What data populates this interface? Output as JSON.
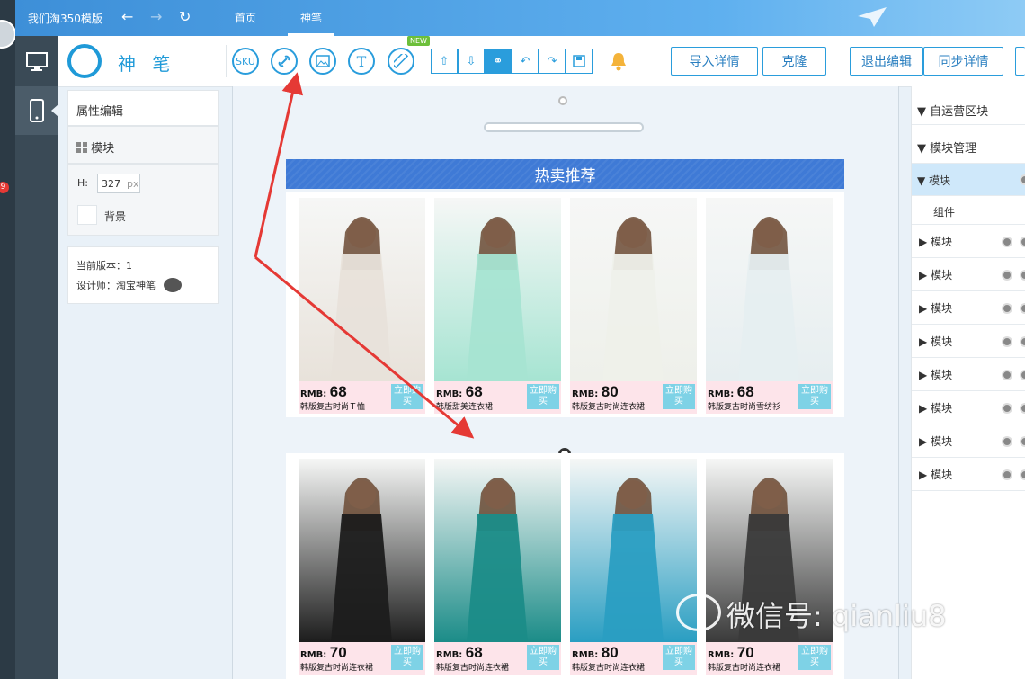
{
  "app": {
    "title": "我们淘350模版"
  },
  "top_tabs": [
    {
      "label": "首页"
    },
    {
      "label": "神笔"
    }
  ],
  "logo": {
    "text": "神 笔"
  },
  "toolbar": {
    "circle_icons": [
      {
        "name": "sku-icon",
        "label": "SKU"
      },
      {
        "name": "link-icon",
        "label": ""
      },
      {
        "name": "image-icon",
        "label": ""
      },
      {
        "name": "text-icon",
        "label": "T"
      },
      {
        "name": "ruler-icon",
        "label": ""
      }
    ],
    "new_badge": "NEW",
    "actions": [
      {
        "name": "import-detail-button",
        "label": "导入详情"
      },
      {
        "name": "clone-button",
        "label": "克隆"
      },
      {
        "name": "exit-edit-button",
        "label": "退出编辑"
      },
      {
        "name": "sync-detail-button",
        "label": "同步详情"
      }
    ]
  },
  "props": {
    "header": "属性编辑",
    "module_label": "模块",
    "height_label": "H:",
    "height_value": "327",
    "height_unit": "px",
    "background_label": "背景",
    "version_text": "当前版本：1",
    "designer_text": "设计师：淘宝神笔"
  },
  "canvas": {
    "banner_title": "热卖推荐",
    "row1": [
      {
        "rmb": "RMB:",
        "price": "68",
        "name": "韩版复古时尚Ｔ恤",
        "buy": "立即购买",
        "color": "#e8e2da"
      },
      {
        "rmb": "RMB:",
        "price": "68",
        "name": "韩版甜美连衣裙",
        "buy": "立即购买",
        "color": "#a6e4d2"
      },
      {
        "rmb": "RMB:",
        "price": "80",
        "name": "韩版复古时尚连衣裙",
        "buy": "立即购买",
        "color": "#eef0ea"
      },
      {
        "rmb": "RMB:",
        "price": "68",
        "name": "韩版复古时尚雪纺衫",
        "buy": "立即购买",
        "color": "#e6eef0"
      }
    ],
    "row2": [
      {
        "rmb": "RMB:",
        "price": "70",
        "name": "韩版复古时尚连衣裙",
        "buy": "立即购买",
        "color": "#1c1c1c"
      },
      {
        "rmb": "RMB:",
        "price": "68",
        "name": "韩版复古时尚连衣裙",
        "buy": "立即购买",
        "color": "#1b8c88"
      },
      {
        "rmb": "RMB:",
        "price": "80",
        "name": "韩版复古时尚连衣裙",
        "buy": "立即购买",
        "color": "#2a9ec2"
      },
      {
        "rmb": "RMB:",
        "price": "70",
        "name": "韩版复古时尚连衣裙",
        "buy": "立即购买",
        "color": "#3a3a3a"
      }
    ]
  },
  "right_panel": {
    "section1": "自运营区块",
    "section2": "模块管理",
    "selected_module": "模块",
    "component": "组件",
    "modules": [
      "模块",
      "模块",
      "模块",
      "模块",
      "模块",
      "模块",
      "模块",
      "模块"
    ]
  },
  "watermark": "微信号: qianliu8",
  "colors": {
    "accent": "#2a9ddc",
    "banner": "#3f7ad6",
    "arrow": "#e53935"
  }
}
